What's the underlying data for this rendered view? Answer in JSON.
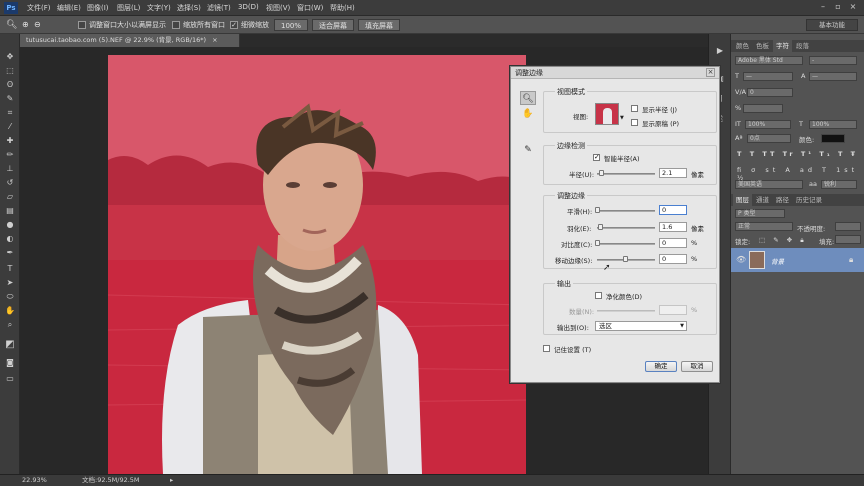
{
  "app": {
    "logo": "Ps",
    "menu": [
      "文件(F)",
      "编辑(E)",
      "图像(I)",
      "图层(L)",
      "文字(Y)",
      "选择(S)",
      "滤镜(T)",
      "3D(D)",
      "视图(V)",
      "窗口(W)",
      "帮助(H)"
    ],
    "window_controls": [
      "minimize-icon",
      "restore-icon",
      "close-icon"
    ]
  },
  "options_bar": {
    "resize_windows": "调整窗口大小以满屏显示",
    "resize_windows_checked": false,
    "zoom_all": "缩放所有窗口",
    "zoom_all_checked": false,
    "scrubby_zoom": "细微缩放",
    "scrubby_zoom_checked": true,
    "btn_100": "100%",
    "btn_fit": "适合屏幕",
    "btn_fill": "填充屏幕",
    "workspace": "基本功能"
  },
  "document": {
    "tab_title": "tutusucai.taobao.com (5).NEF @ 22.9% (背景, RGB/16*)",
    "tab_close": "×"
  },
  "status": {
    "zoom": "22.93%",
    "doc_info": "文档:92.5M/92.5M"
  },
  "right_panel": {
    "char_tabs": [
      "颜色",
      "色板",
      "字符",
      "段落"
    ],
    "char_active": "字符",
    "font_family": "Adobe 黑体 Std",
    "font_style": "-",
    "size_a": "—",
    "size_b": "—",
    "leading_label": "0",
    "scale_a": "100%",
    "scale_b": "100%",
    "baseline": "0点",
    "color_label": "颜色:",
    "language": "美国英语",
    "aa": "锐利",
    "layer_tabs": [
      "图层",
      "通道",
      "路径",
      "历史记录"
    ],
    "layers_active": "图层",
    "filter_label": "P 类型",
    "blend_mode": "正常",
    "opacity_label": "不透明度:",
    "lock_label": "锁定:",
    "fill_label": "填充:",
    "layer_name": "背景"
  },
  "dialog": {
    "title": "调整边缘",
    "view_mode": {
      "title": "视图模式",
      "view_label": "视图:",
      "show_radius": "显示半径 (J)",
      "show_radius_checked": false,
      "show_original": "显示原稿 (P)",
      "show_original_checked": false
    },
    "edge_detection": {
      "title": "边缘检测",
      "smart_radius": "智能半径(A)",
      "smart_radius_checked": true,
      "radius_label": "半径(U):",
      "radius_value": "2.1",
      "radius_unit": "像素"
    },
    "adjust_edge": {
      "title": "调整边缘",
      "smooth_label": "平滑(H):",
      "smooth_value": "0",
      "feather_label": "羽化(E):",
      "feather_value": "1.6",
      "feather_unit": "像素",
      "contrast_label": "对比度(C):",
      "contrast_value": "0",
      "contrast_unit": "%",
      "shift_label": "移动边缘(S):",
      "shift_value": "0",
      "shift_unit": "%"
    },
    "output": {
      "title": "输出",
      "decontaminate": "净化颜色(D)",
      "decontaminate_checked": false,
      "amount_label": "数量(N):",
      "amount_unit": "%",
      "output_to_label": "输出到(O):",
      "output_to_value": "选区"
    },
    "remember": "记住设置 (T)",
    "remember_checked": false,
    "ok": "确定",
    "cancel": "取消"
  }
}
